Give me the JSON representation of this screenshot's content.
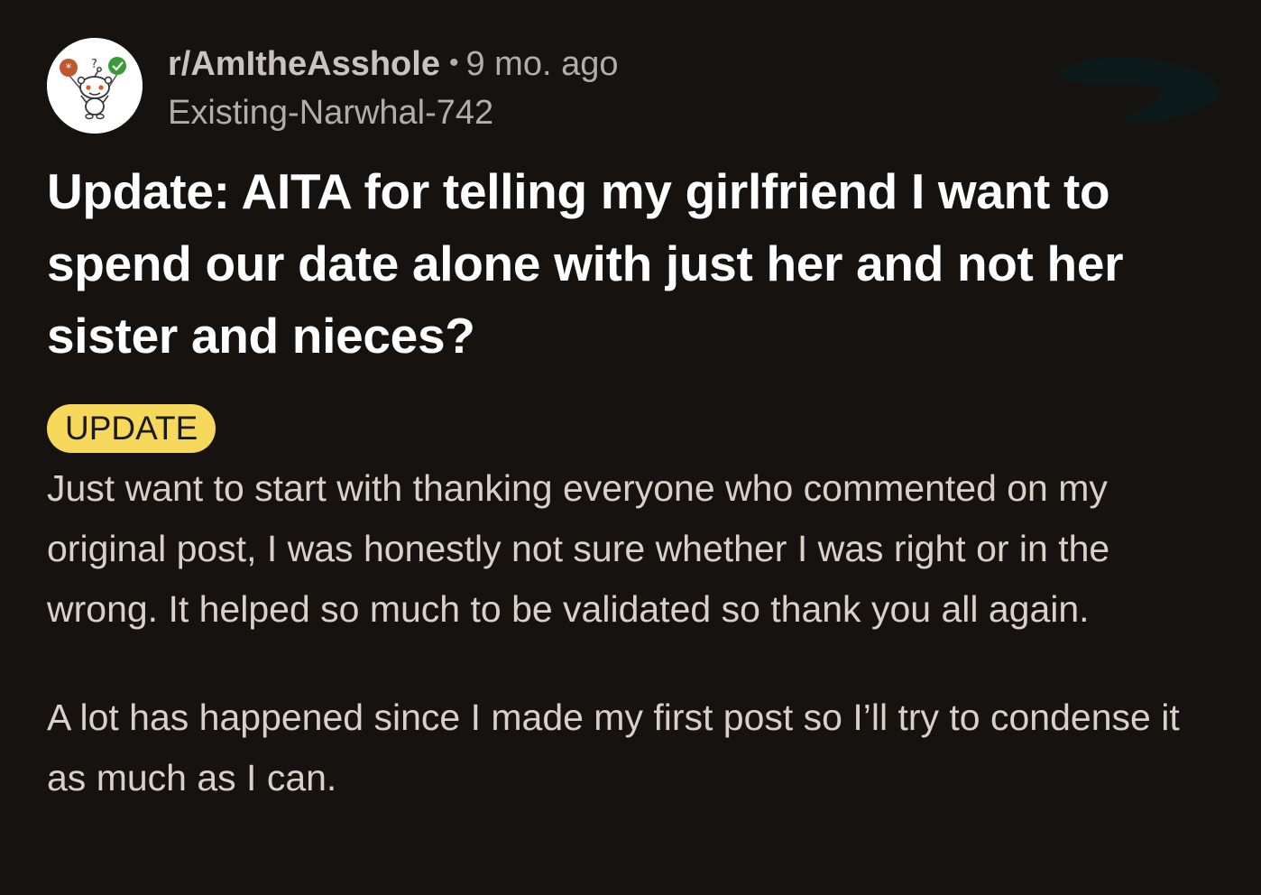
{
  "post": {
    "subreddit": "r/AmItheAsshole",
    "separator": "•",
    "age": "9 mo. ago",
    "author": "Existing-Narwhal-742",
    "title": "Update: AITA for telling my girlfriend I want to spend our date alone with just her and not her sister and nieces?",
    "flair": "UPDATE",
    "paragraphs": [
      "Just want to start with thanking everyone who commented on my original post, I was honestly not sure whether I was right or in the wrong. It helped so much to be validated so thank you all again.",
      "A lot has happened since I made my first post so I’ll try to condense it as much as I can."
    ]
  },
  "colors": {
    "background": "#161210",
    "title": "#ffffff",
    "body": "#d9d0c8",
    "muted": "#b2ada8",
    "flair_bg": "#f6d85a",
    "flair_text": "#1a1a1a",
    "redaction": "#0d1a1c"
  },
  "icons": {
    "avatar": "subreddit-avatar-icon"
  }
}
